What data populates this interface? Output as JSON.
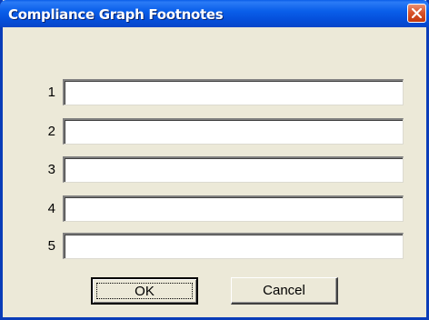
{
  "window": {
    "title": "Compliance Graph Footnotes",
    "close_icon": "close-icon"
  },
  "footnotes": [
    {
      "label": "1",
      "value": ""
    },
    {
      "label": "2",
      "value": ""
    },
    {
      "label": "3",
      "value": ""
    },
    {
      "label": "4",
      "value": ""
    },
    {
      "label": "5",
      "value": ""
    }
  ],
  "buttons": {
    "ok_label": "OK",
    "cancel_label": "Cancel"
  }
}
